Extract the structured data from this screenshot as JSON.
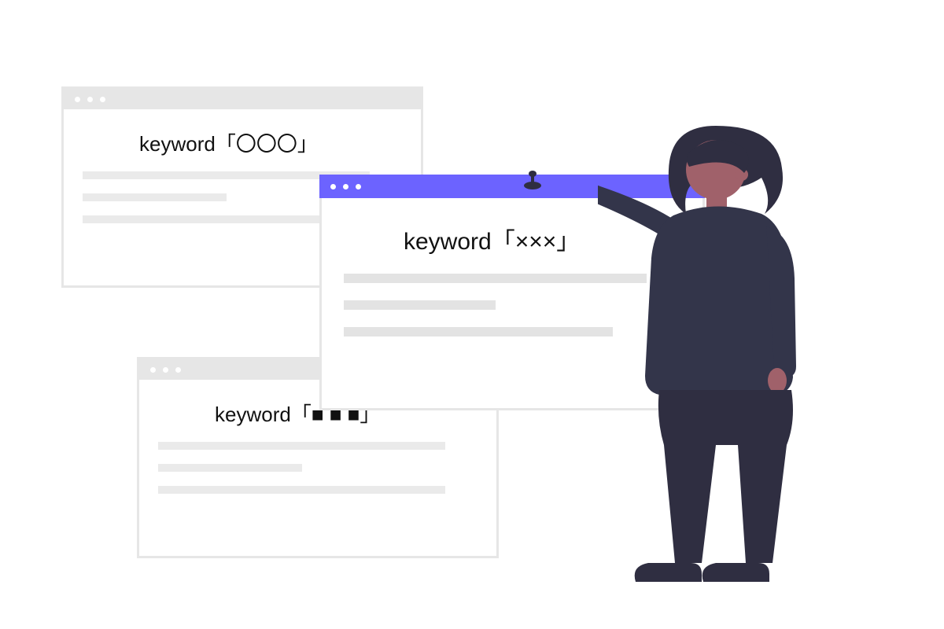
{
  "windows": {
    "w1": {
      "keyword": "keyword「〇〇〇」"
    },
    "w2": {
      "keyword": "keyword「×××」"
    },
    "w3": {
      "keyword": "keyword「■ ■ ■」"
    }
  },
  "colors": {
    "accent": "#6c63ff",
    "panel_border": "#e6e6e6",
    "placeholder_line": "#e3e3e3",
    "person_suit": "#33354a",
    "person_skin": "#a0616a",
    "person_hair": "#2f2e41"
  },
  "icons": {
    "window_dots": "window-control-dot",
    "thumbtack": "pin-icon"
  }
}
